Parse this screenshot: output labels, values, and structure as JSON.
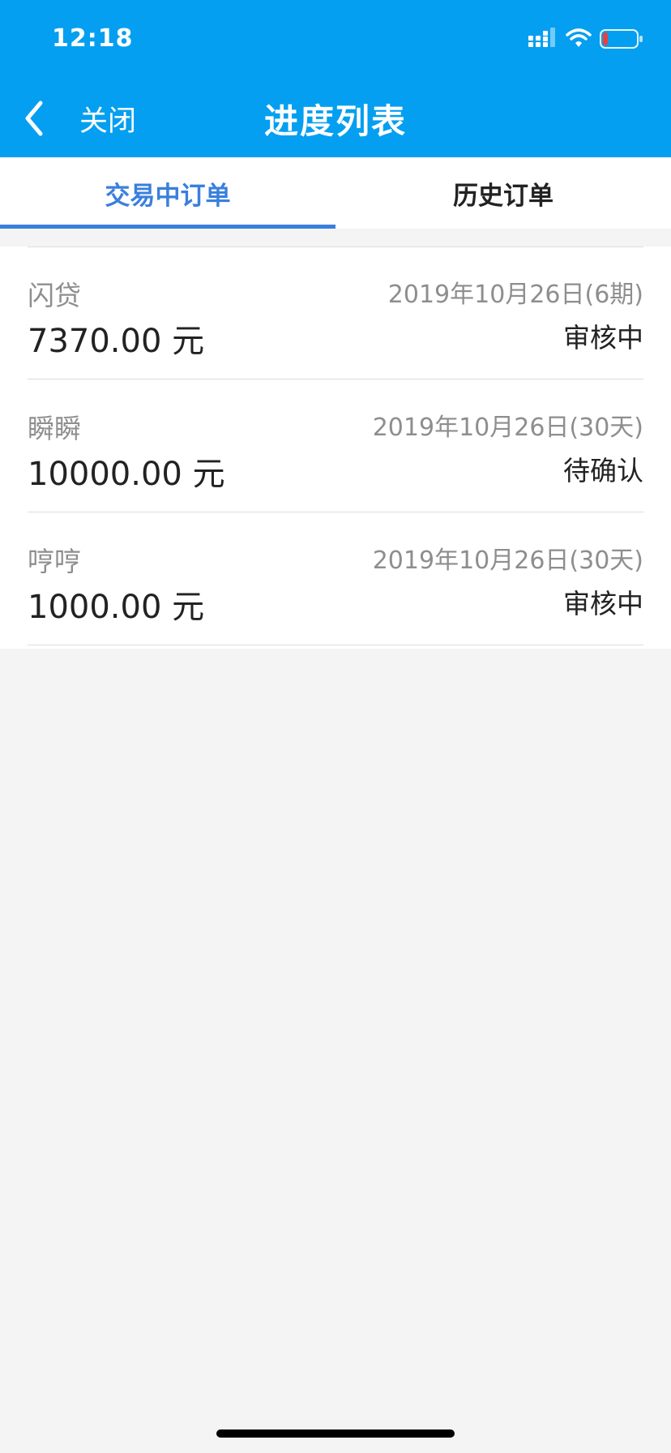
{
  "status_bar": {
    "time": "12:18"
  },
  "nav": {
    "back_label": "关闭",
    "title": "进度列表"
  },
  "tabs": [
    {
      "label": "交易中订单",
      "active": true
    },
    {
      "label": "历史订单",
      "active": false
    }
  ],
  "orders": [
    {
      "name": "闪贷",
      "date": "2019年10月26日(6期)",
      "amount": "7370.00 元",
      "status": "审核中"
    },
    {
      "name": "瞬瞬",
      "date": "2019年10月26日(30天)",
      "amount": "10000.00 元",
      "status": "待确认"
    },
    {
      "name": "哼哼",
      "date": "2019年10月26日(30天)",
      "amount": "1000.00 元",
      "status": "审核中"
    }
  ],
  "colors": {
    "header_blue": "#049ff0",
    "tab_active": "#3a7fdd",
    "battery_low": "#e8413c"
  },
  "icons": {
    "back": "chevron-left-icon",
    "signal": "signal-icon",
    "wifi": "wifi-icon",
    "battery": "battery-icon"
  }
}
